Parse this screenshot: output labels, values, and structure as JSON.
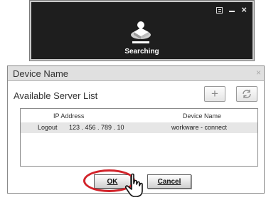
{
  "search_window": {
    "status_label": "Searching",
    "controls": [
      "menu-icon",
      "minimize-icon",
      "close-icon"
    ],
    "close_glyph": "×"
  },
  "dialog": {
    "title": "Device Name",
    "close_glyph": "×",
    "list_heading": "Available Server List",
    "add_glyph": "+",
    "columns": {
      "ip": "IP Address",
      "device": "Device Name"
    },
    "rows": [
      {
        "action": "Logout",
        "ip": "123 . 456 . 789 . 10",
        "device": "workware - connect"
      }
    ],
    "ok_label": "OK",
    "cancel_label": "Cancel"
  },
  "colors": {
    "highlight": "#d2232a",
    "search_bg": "#1e1e1e"
  }
}
